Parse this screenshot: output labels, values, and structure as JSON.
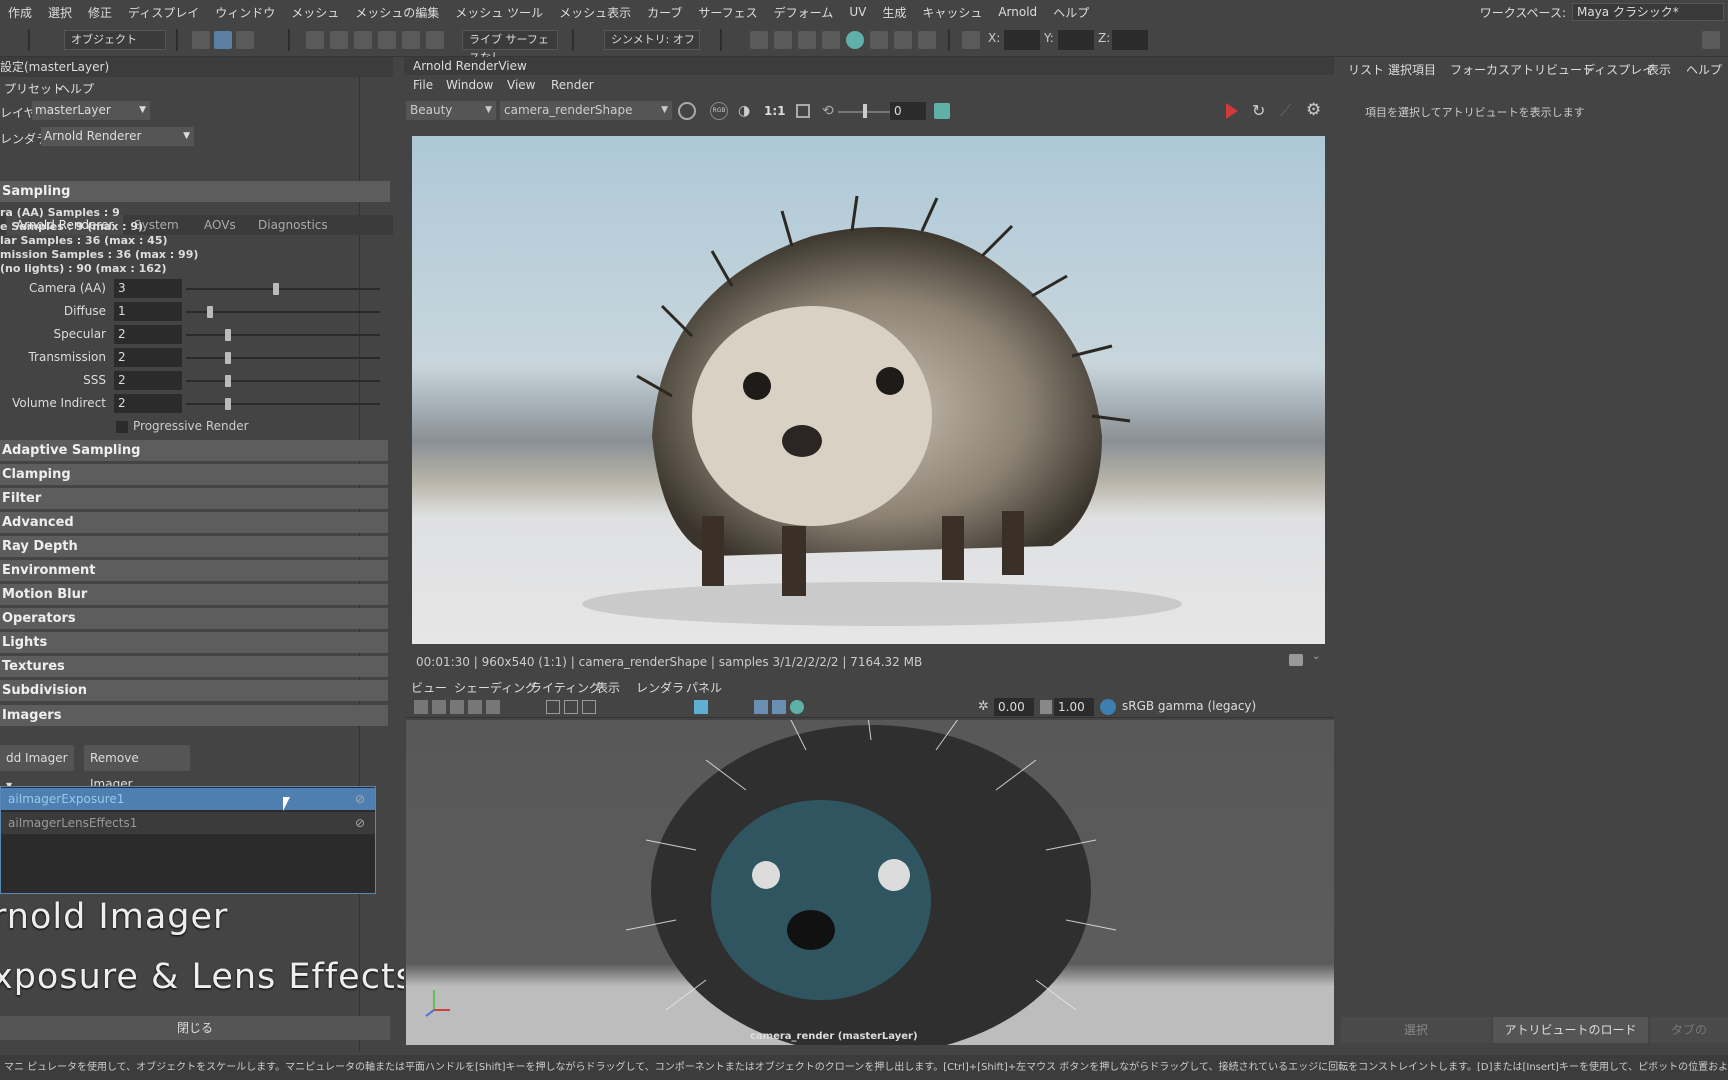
{
  "menubar": {
    "items": [
      "作成",
      "選択",
      "修正",
      "ディスプレイ",
      "ウィンドウ",
      "メッシュ",
      "メッシュの編集",
      "メッシュ ツール",
      "メッシュ表示",
      "カーブ",
      "サーフェス",
      "デフォーム",
      "UV",
      "生成",
      "キャッシュ",
      "Arnold",
      "ヘルプ"
    ],
    "workspace_label": "ワークスペース:",
    "workspace_value": "Maya クラシック*"
  },
  "toolbar": {
    "object_mode": "オブジェクト",
    "live_surface": "ライブ サーフェスなし",
    "symmetry": "シンメトリ: オフ",
    "x_label": "X:",
    "y_label": "Y:",
    "z_label": "Z:"
  },
  "left": {
    "window_title": "設定(masterLayer)",
    "menu_preset": "プリセット",
    "menu_help": "ヘルプ",
    "layer_label": "レイヤ",
    "layer_value": "masterLayer",
    "renderer_label": "レンダラ",
    "renderer_value": "Arnold Renderer",
    "tabs": [
      "Arnold Renderer",
      "System",
      "AOVs",
      "Diagnostics"
    ],
    "sampling_title": "Sampling",
    "sampling_info": [
      "ra (AA) Samples : 9",
      "e Samples : 9 (max : 9)",
      "lar Samples : 36 (max : 45)",
      "mission Samples : 36 (max : 99)",
      "(no lights) : 90 (max : 162)"
    ],
    "params": [
      {
        "label": "Camera (AA)",
        "value": "3"
      },
      {
        "label": "Diffuse",
        "value": "1"
      },
      {
        "label": "Specular",
        "value": "2"
      },
      {
        "label": "Transmission",
        "value": "2"
      },
      {
        "label": "SSS",
        "value": "2"
      },
      {
        "label": "Volume Indirect",
        "value": "2"
      }
    ],
    "progressive_render": "Progressive Render",
    "sections": [
      "Adaptive Sampling",
      "Clamping",
      "Filter",
      "Advanced",
      "Ray Depth",
      "Environment",
      "Motion Blur",
      "Operators",
      "Lights",
      "Textures",
      "Subdivision",
      "Imagers"
    ],
    "add_imager": "dd Imager",
    "remove_imager": "Remove Imager",
    "imagers": [
      "aiImagerExposure1",
      "aiImagerLensEffects1"
    ],
    "overlay_line1": "rnold Imager",
    "overlay_line2": "xposure & Lens Effects",
    "close_button": "閉じる"
  },
  "renderview": {
    "title": "Arnold RenderView",
    "menu": [
      "File",
      "Window",
      "View",
      "Render"
    ],
    "aov": "Beauty",
    "camera": "camera_renderShape",
    "ratio": "1:1",
    "exposure_value": "0",
    "status": "00:01:30 | 960x540 (1:1) | camera_renderShape | samples 3/1/2/2/2/2 | 7164.32 MB"
  },
  "viewport": {
    "menu": [
      "ビュー",
      "シェーディング",
      "ライティング",
      "表示",
      "レンダラ",
      "パネル"
    ],
    "value1": "0.00",
    "value2": "1.00",
    "colorspace": "sRGB gamma (legacy)",
    "camera_label": "camera_render (masterLayer)"
  },
  "right": {
    "tabs": [
      "リスト",
      "選択項目",
      "フォーカス",
      "アトリビュート",
      "ディスプレイ",
      "表示",
      "ヘルプ"
    ],
    "hint": "項目を選択してアトリビュートを表示します",
    "btn_select": "選択",
    "btn_load": "アトリビュートのロード",
    "btn_tab": "タブの"
  },
  "status_bar": "マニ ピュレータを使用して、オブジェクトをスケールします。マニピュレータの軸または平面ハンドルを[Shift]キーを押しながらドラッグして、コンポーネントまたはオブジェクトのクローンを押し出します。[Ctrl]+[Shift]+左マウス ボタンを押しながらドラッグして、接続されているエッジに回転をコンストレイントします。[D]または[Insert]キーを使用して、ピボットの位置および軸の方向を変更します。",
  "colors": {
    "accent": "#5a87b8",
    "selected_row": "#4f7fb0",
    "panel": "#444444",
    "field": "#2b2b2b"
  }
}
